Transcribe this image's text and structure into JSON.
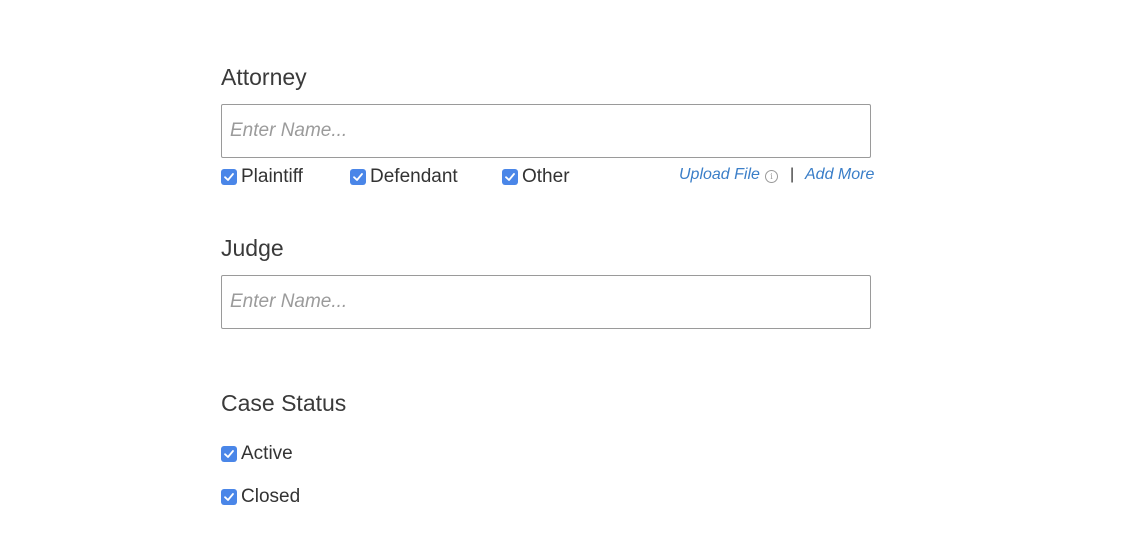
{
  "attorney": {
    "label": "Attorney",
    "placeholder": "Enter Name...",
    "roles": [
      {
        "label": "Plaintiff",
        "checked": true
      },
      {
        "label": "Defendant",
        "checked": true
      },
      {
        "label": "Other",
        "checked": true
      }
    ],
    "upload_label": "Upload File",
    "info_icon": "info-circle-icon",
    "separator": "|",
    "add_more_label": "Add More"
  },
  "judge": {
    "label": "Judge",
    "placeholder": "Enter Name..."
  },
  "case_status": {
    "label": "Case Status",
    "options": [
      {
        "label": "Active",
        "checked": true
      },
      {
        "label": "Closed",
        "checked": true
      }
    ]
  },
  "colors": {
    "checkbox": "#4a86e8",
    "link": "#3a7ec8",
    "input_border": "#9a9a9a"
  }
}
